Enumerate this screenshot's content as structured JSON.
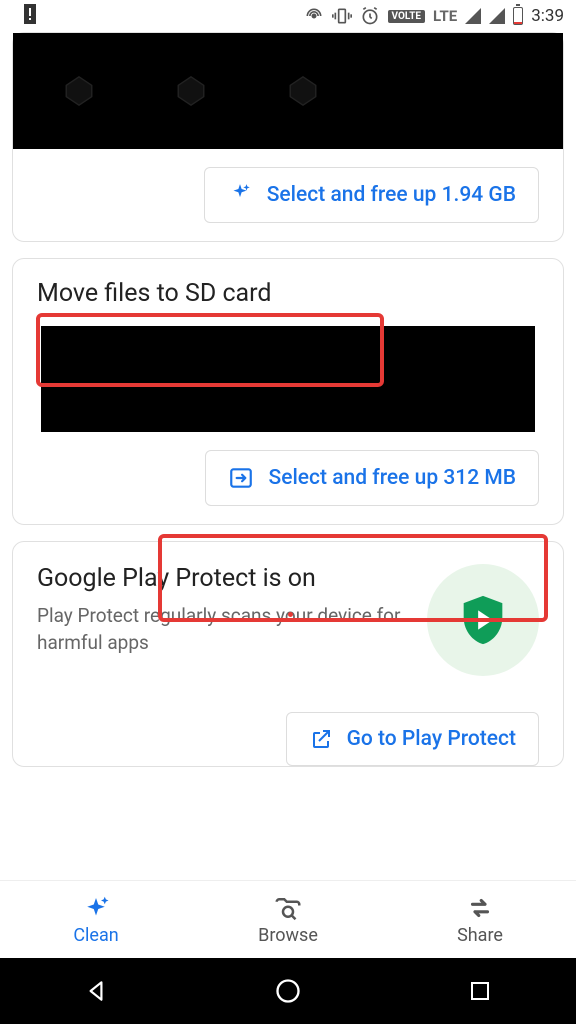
{
  "status": {
    "time": "3:39",
    "lte": "LTE",
    "volte": "VOLTE"
  },
  "card1": {
    "button_label": "Select and free up 1.94 GB"
  },
  "card2": {
    "title": "Move files to SD card",
    "button_label": "Select and free up 312 MB"
  },
  "card3": {
    "title": "Google Play Protect is on",
    "subtitle": "Play Protect regularly scans your device for harmful apps",
    "button_label": "Go to Play Protect"
  },
  "nav": {
    "clean": "Clean",
    "browse": "Browse",
    "share": "Share"
  }
}
